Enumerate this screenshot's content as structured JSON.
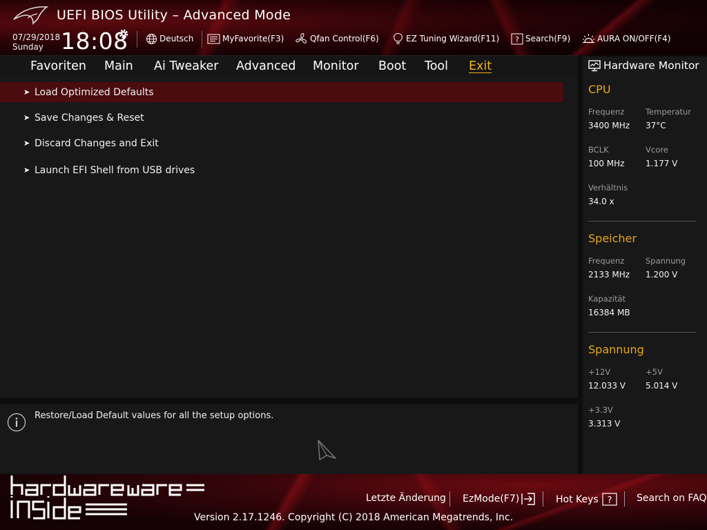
{
  "header": {
    "app_title": "UEFI BIOS Utility – Advanced Mode",
    "date": "07/29/2018",
    "weekday": "Sunday",
    "time": "18:08"
  },
  "toolbar": {
    "language": "Deutsch",
    "myfavorite": "MyFavorite(F3)",
    "qfan": "Qfan Control(F6)",
    "ez_tuning": "EZ Tuning Wizard(F11)",
    "search": "Search(F9)",
    "aura": "AURA ON/OFF(F4)"
  },
  "menu": {
    "tabs": [
      {
        "label": "Favoriten"
      },
      {
        "label": "Main"
      },
      {
        "label": "Ai Tweaker"
      },
      {
        "label": "Advanced"
      },
      {
        "label": "Monitor"
      },
      {
        "label": "Boot"
      },
      {
        "label": "Tool"
      },
      {
        "label": "Exit"
      }
    ],
    "active_tab": "Exit"
  },
  "exit_items": [
    {
      "label": "Load Optimized Defaults",
      "selected": true
    },
    {
      "label": "Save Changes & Reset",
      "selected": false
    },
    {
      "label": "Discard Changes and Exit",
      "selected": false
    },
    {
      "label": "Launch EFI Shell from USB drives",
      "selected": false
    }
  ],
  "help": {
    "text": "Restore/Load Default values for all the setup options."
  },
  "hw_monitor": {
    "title": "Hardware Monitor",
    "cpu": {
      "title": "CPU",
      "freq_label": "Frequenz",
      "freq_value": "3400 MHz",
      "temp_label": "Temperatur",
      "temp_value": "37°C",
      "bclk_label": "BCLK",
      "bclk_value": "100 MHz",
      "vcore_label": "Vcore",
      "vcore_value": "1.177 V",
      "ratio_label": "Verhältnis",
      "ratio_value": "34.0 x"
    },
    "memory": {
      "title": "Speicher",
      "freq_label": "Frequenz",
      "freq_value": "2133 MHz",
      "volt_label": "Spannung",
      "volt_value": "1.200 V",
      "cap_label": "Kapazität",
      "cap_value": "16384 MB"
    },
    "voltage": {
      "title": "Spannung",
      "v12_label": "+12V",
      "v12_value": "12.033 V",
      "v5_label": "+5V",
      "v5_value": "5.014 V",
      "v33_label": "+3.3V",
      "v33_value": "3.313 V"
    }
  },
  "footer": {
    "last_change": "Letzte Änderung",
    "ezmode": "EzMode(F7)",
    "hot_keys": "Hot Keys",
    "search_faq": "Search on FAQ",
    "copyright": "Version 2.17.1246. Copyright (C) 2018 American Megatrends, Inc.",
    "watermark_text": "hardware inside"
  },
  "colors": {
    "accent": "#e8a51a",
    "active_tab": "#f2b21b",
    "selected_row": "#4a0c0e",
    "brand_red": "#8a0f16"
  },
  "icons": [
    "rog-logo",
    "gear-icon",
    "globe-icon",
    "favorite-list-icon",
    "fan-icon",
    "bulb-icon",
    "help-box-icon",
    "aura-icon",
    "monitor-icon",
    "info-icon",
    "mouse-cursor-icon",
    "exit-arrow-icon",
    "question-box-icon"
  ]
}
